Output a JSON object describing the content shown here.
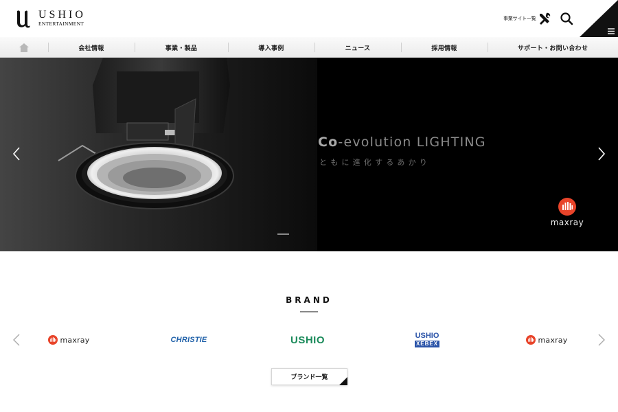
{
  "header": {
    "logo_main": "USHIO",
    "logo_sub": "ENTERTAINMENT",
    "site_list_label": "事業サイト一覧",
    "site_list_icon": "tools-icon",
    "search_icon": "search-icon",
    "menu_icon": "hamburger-menu-icon"
  },
  "nav": {
    "home_icon": "home-icon",
    "items": [
      {
        "label": "会社情報"
      },
      {
        "label": "事業・製品"
      },
      {
        "label": "導入事例"
      },
      {
        "label": "ニュース"
      },
      {
        "label": "採用情報"
      },
      {
        "label": "サポート・お問い合わせ"
      }
    ]
  },
  "hero": {
    "title_prefix": "Co",
    "title_rest": "-evolution LIGHTING",
    "subtitle": "ともに進化するあかり",
    "brand": "maxray",
    "prev_icon": "chevron-left-icon",
    "next_icon": "chevron-right-icon",
    "slide_count": 1,
    "active_slide": 1
  },
  "brand_section": {
    "heading": "BRAND",
    "logos": [
      {
        "name": "maxray",
        "text": "maxray"
      },
      {
        "name": "christie",
        "text": "CHRISTIE"
      },
      {
        "name": "ushio",
        "text": "USHIO"
      },
      {
        "name": "ushio-xebex",
        "text_top": "USHIO",
        "text_bottom": "XEBEX"
      },
      {
        "name": "maxray",
        "text": "maxray"
      }
    ],
    "list_button": "ブランド一覧"
  },
  "colors": {
    "accent_red": "#e8442a",
    "christie_blue": "#1d5fa8",
    "ushio_green": "#1a8a5a",
    "xebex_blue": "#2a53a8"
  }
}
